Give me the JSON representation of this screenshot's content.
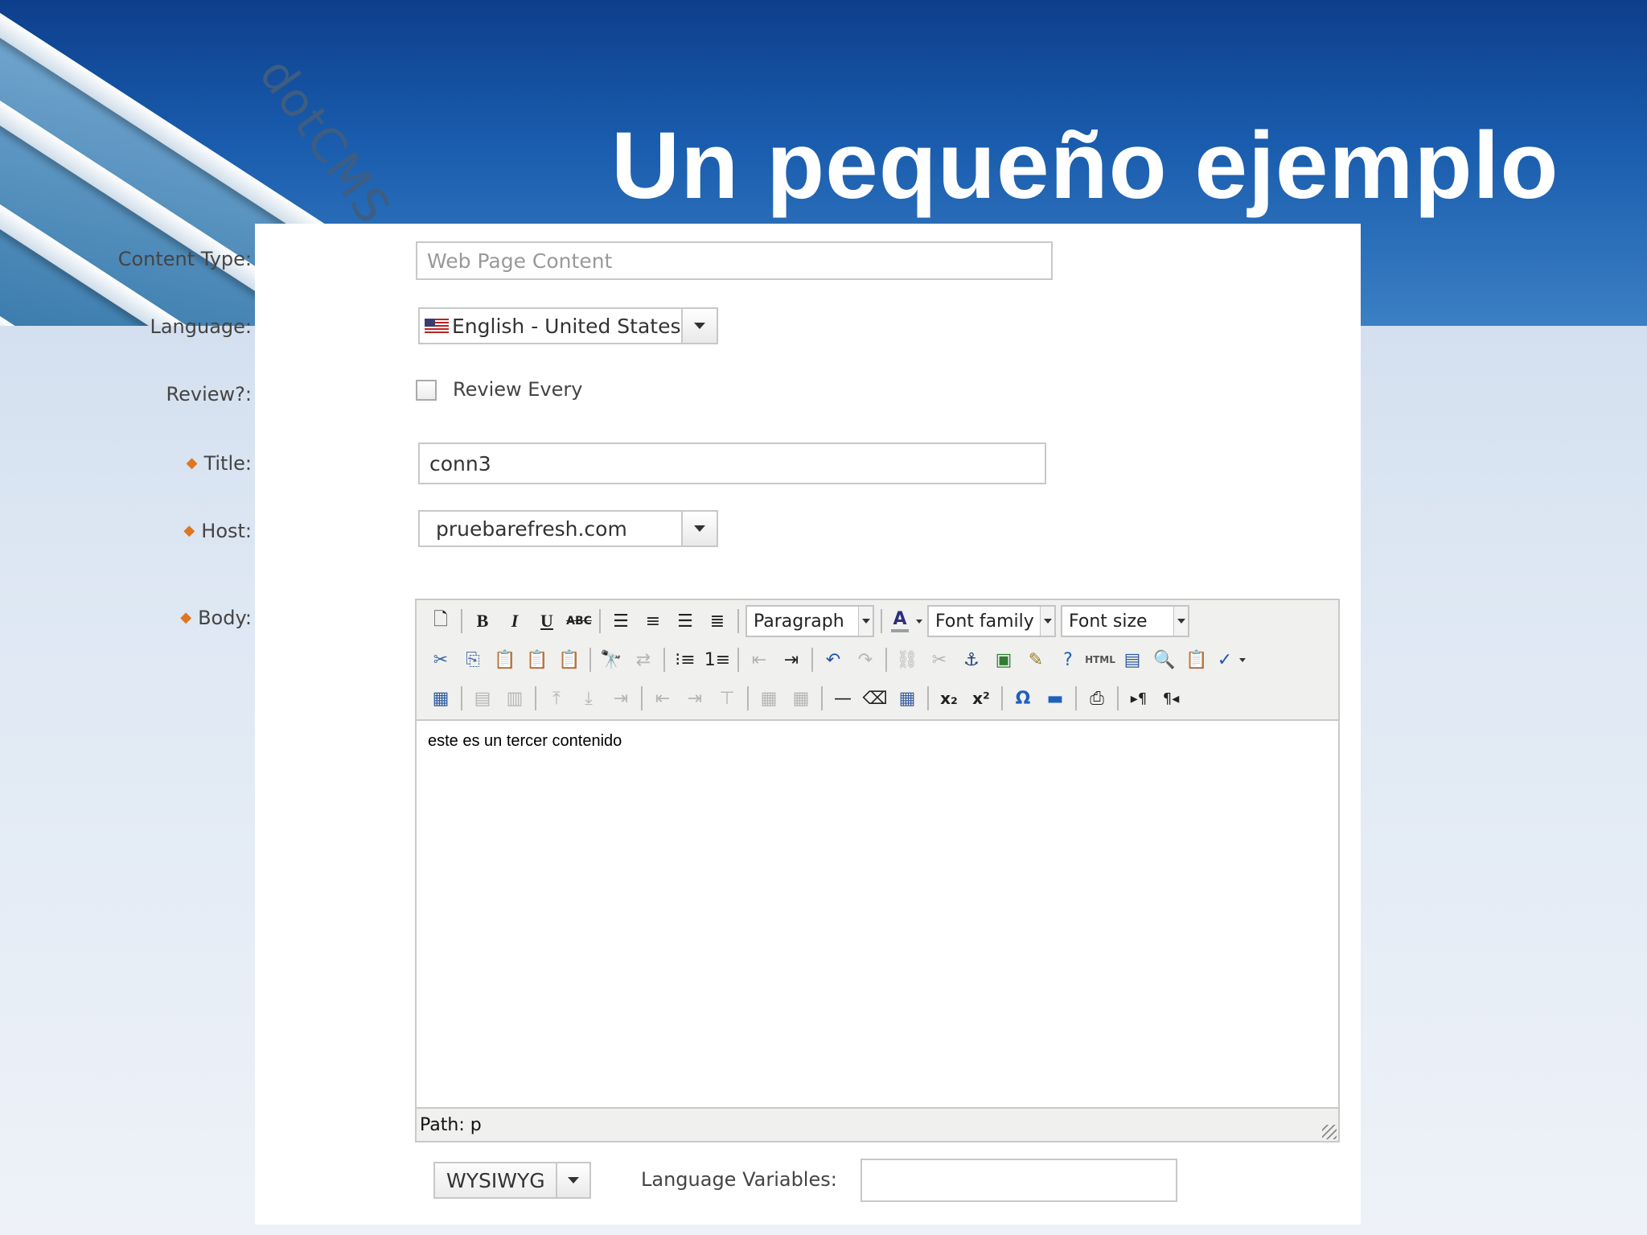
{
  "slide": {
    "title": "Un pequeño ejemplo",
    "brand_logo": "dotCMS"
  },
  "form": {
    "content_type": {
      "label": "Content Type:",
      "placeholder": "Web Page Content"
    },
    "language": {
      "label": "Language:",
      "value": "English - United States"
    },
    "review": {
      "label": "Review?:",
      "checkbox_label": "Review Every",
      "checked": false
    },
    "title": {
      "label": "Title:",
      "value": "conn3",
      "required": true
    },
    "host": {
      "label": "Host:",
      "value": "pruebarefresh.com",
      "required": true
    },
    "body": {
      "label": "Body:",
      "required": true,
      "toolbar": {
        "format_select": "Paragraph",
        "font_family_select": "Font family",
        "font_size_select": "Font size",
        "html_label": "HTML"
      },
      "content": "este es un tercer contenido",
      "status_path": "Path: p"
    },
    "editor_mode": {
      "value": "WYSIWYG"
    },
    "language_variables": {
      "label": "Language Variables:",
      "value": ""
    }
  },
  "colors": {
    "banner_blue": "#1a5dae",
    "required_marker": "#e0761e",
    "panel_bg": "#ffffff"
  },
  "icons": [
    "new-document-icon",
    "bold-icon",
    "italic-icon",
    "underline-icon",
    "strikethrough-icon",
    "align-left-icon",
    "align-center-icon",
    "align-right-icon",
    "align-justify-icon",
    "text-color-icon",
    "cut-icon",
    "copy-icon",
    "paste-icon",
    "paste-text-icon",
    "paste-word-icon",
    "find-icon",
    "replace-icon",
    "bullet-list-icon",
    "numbered-list-icon",
    "outdent-icon",
    "indent-icon",
    "undo-icon",
    "redo-icon",
    "link-icon",
    "unlink-icon",
    "anchor-icon",
    "image-icon",
    "cleanup-icon",
    "help-icon",
    "html-icon",
    "media-icon",
    "preview-icon",
    "paste-plain-icon",
    "spellcheck-icon",
    "insert-table-icon",
    "table-row-props-icon",
    "table-cell-props-icon",
    "row-before-icon",
    "row-after-icon",
    "delete-row-icon",
    "col-before-icon",
    "col-after-icon",
    "delete-col-icon",
    "split-cells-icon",
    "merge-cells-icon",
    "horizontal-rule-icon",
    "remove-format-icon",
    "visual-aid-icon",
    "subscript-icon",
    "superscript-icon",
    "special-char-icon",
    "hr-advanced-icon",
    "print-icon",
    "ltr-icon",
    "rtl-icon",
    "resize-grip-icon",
    "flag-icon"
  ]
}
